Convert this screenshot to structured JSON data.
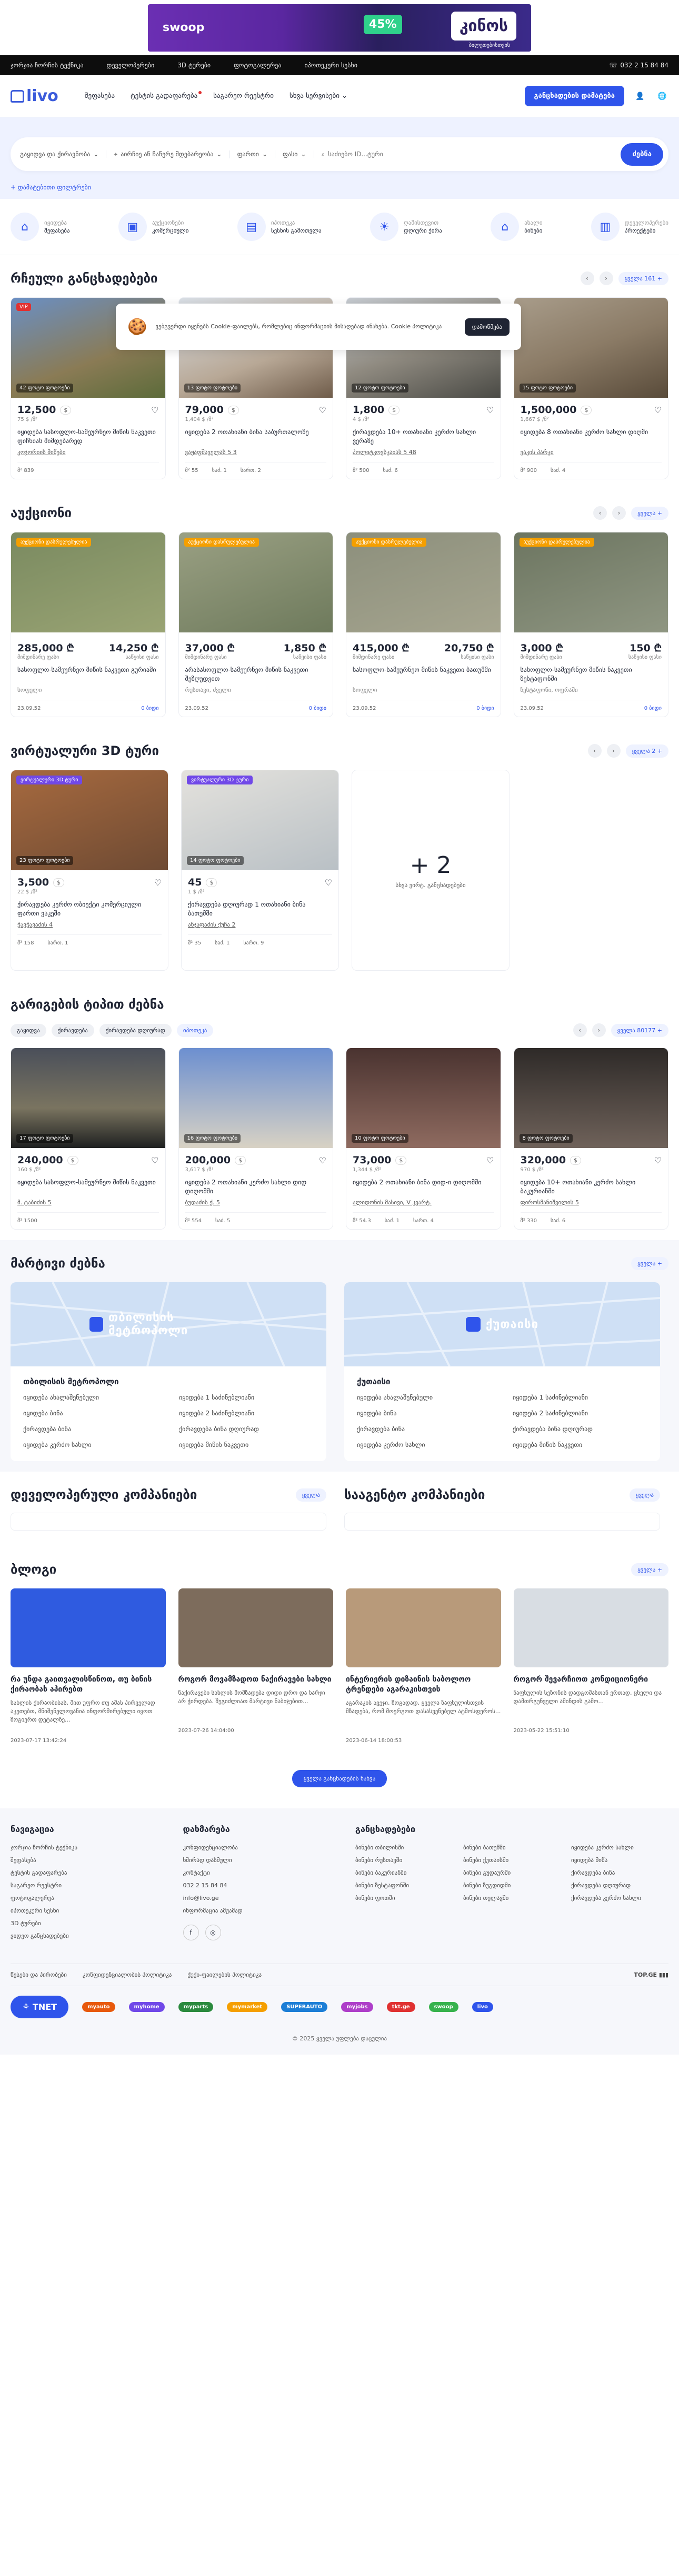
{
  "banner": {
    "logo": "swoop",
    "percent": "45%",
    "headline": "კინოს",
    "sub": "ბილეთებისთვის"
  },
  "topbar": {
    "links": [
      "ჯორჯია ჩორჩის ტექნიკა",
      "დეველოპერები",
      "3D ტურები",
      "ფოტოგალერეა",
      "იპოთეკური სესხი"
    ],
    "phone": "032 2 15 84 84"
  },
  "header": {
    "logo": "livo",
    "nav": [
      "შეფასება",
      "ტესტის გადაფარება",
      "საგარეო რეესტრი",
      "სხვა სერვისები"
    ],
    "cta": "განცხადების დამატება"
  },
  "search": {
    "deal": "გაყიდვა და ქირავნობა",
    "type": "აირჩიე ან ჩაწერე მდებარეობა",
    "price": "ფართი",
    "area": "ფასი",
    "id_placeholder": "საძიებო ID...ტური",
    "button": "ძებნა",
    "advanced": "დამატებითი ფილტრები"
  },
  "categories": [
    {
      "top": "იყიდება",
      "main": "შეფასება",
      "icon": "house-icon"
    },
    {
      "top": "აუქციონები",
      "main": "კომერციული",
      "icon": "briefcase-icon"
    },
    {
      "top": "იპოთეკა",
      "main": "სესხის გამოთვლა",
      "icon": "document-icon"
    },
    {
      "top": "ღამისთევით",
      "main": "დღიური ქირა",
      "icon": "sun-icon"
    },
    {
      "top": "ახალი",
      "main": "ბინები",
      "icon": "building-icon"
    },
    {
      "top": "დეველოპერები",
      "main": "პროექტები",
      "icon": "city-icon"
    }
  ],
  "sections": {
    "rent": {
      "title": "რჩეული განცხადებები",
      "more": "ყველა 161 +"
    },
    "auction": {
      "title": "აუქციონი",
      "more": "ყველა +"
    },
    "tour": {
      "title": "ვირტუალური 3D ტური",
      "more": "ყველა 2 +"
    },
    "popular": {
      "title": "გარიგების ტიპით ძებნა",
      "more": "ყველა 80177 +"
    },
    "maps": {
      "title": "მარტივი ძებნა",
      "more": "ყველა +"
    },
    "dev": {
      "title": "დეველოპერული კომპანიები",
      "more": "ყველა"
    },
    "agency": {
      "title": "სააგენტო კომპანიები",
      "more": "ყველა"
    },
    "blog": {
      "title": "ბლოგი",
      "more": "ყველა +"
    }
  },
  "cookie": {
    "text": "ვებგვერდი იყენებს Cookie-ფაილებს, რომლებიც ინფორმაციის მისაღებად ინახება. Cookie პოლიტიკა",
    "button": "დამოწმება"
  },
  "rent_cards": [
    {
      "price": "12,500",
      "cur": "$",
      "sub": "75 $ /მ²",
      "tag": "42 ფოტო ფოტოები",
      "vip": "VIP",
      "desc": "იყიდება სასოფლო-სამეურნეო მიწის ნაკვეთი ფიჩხიას მიმდებარედ",
      "addr": "კოჯორიის მიწები",
      "m1": "მ² 839",
      "m2": "",
      "m3": ""
    },
    {
      "price": "79,000",
      "cur": "$",
      "sub": "1,404 $ /მ²",
      "tag": "13 ფოტო ფოტოები",
      "vip": "",
      "desc": "იყიდება 2 ოთახიანი ბინა საბურთალოზე",
      "addr": "ვაჟაფშაველას 5 3",
      "m1": "მ² 55",
      "m2": "საძ. 1",
      "m3": "სართ. 2"
    },
    {
      "price": "1,800",
      "cur": "$",
      "sub": "4 $ /მ²",
      "tag": "12 ფოტო ფოტოები",
      "vip": "",
      "desc": "ქირავდება 10+ ოთახიანი კერძო სახლი ვერაზე",
      "addr": "პოლიტკოვსკაიას 5 48",
      "m1": "მ² 500",
      "m2": "საძ. 6",
      "m3": ""
    },
    {
      "price": "1,500,000",
      "cur": "$",
      "sub": "1,667 $ /მ²",
      "tag": "15 ფოტო ფოტოები",
      "vip": "",
      "desc": "იყიდება 8 ოთახიანი კერძო სახლი დიღმი",
      "addr": "ვაკის პარკი",
      "m1": "მ² 900",
      "m2": "საძ. 4",
      "m3": ""
    }
  ],
  "auction_cards": [
    {
      "status": "აუქციონი დასრულებულია",
      "price": "285,000 ₾",
      "min": "14,250 ₾",
      "l1": "მიმდინარე ფასი",
      "l2": "საწყისი ფასი",
      "desc": "სასოფლო-სამეურნეო მიწის ნაკვეთი გურიაში",
      "addr": "სოფელი",
      "date": "23.09.52",
      "link": "0 ბიდი"
    },
    {
      "status": "აუქციონი დასრულებულია",
      "price": "37,000 ₾",
      "min": "1,850 ₾",
      "l1": "მიმდინარე ფასი",
      "l2": "საწყისი ფასი",
      "desc": "არასასოფლო-სამეურნეო მიწის ნაკვეთი შეზღუდვით",
      "addr": "რუსთავი, ძველი",
      "date": "23.09.52",
      "link": "0 ბიდი"
    },
    {
      "status": "აუქციონი დასრულებულია",
      "price": "415,000 ₾",
      "min": "20,750 ₾",
      "l1": "მიმდინარე ფასი",
      "l2": "საწყისი ფასი",
      "desc": "სასოფლო-სამეურნეო მიწის ნაკვეთი ბათუმში",
      "addr": "სოფელი",
      "date": "23.09.52",
      "link": "0 ბიდი"
    },
    {
      "status": "აუქციონი დასრულებულია",
      "price": "3,000 ₾",
      "min": "150 ₾",
      "l1": "მიმდინარე ფასი",
      "l2": "საწყისი ფასი",
      "desc": "სასოფლო-სამეურნეო მიწის ნაკვეთი ზესტაფონში",
      "addr": "ზესტაფონი, ოფრაში",
      "date": "23.09.52",
      "link": "0 ბიდი"
    }
  ],
  "tour_cards": [
    {
      "badge": "ვირტუალური 3D ტური",
      "price": "3,500",
      "cur": "$",
      "sub": "22 $ /მ²",
      "tag": "23 ფოტო ფოტოები",
      "desc": "ქირავდება კერძო ობიექტი კომერციული ფართი ვაკეში",
      "addr": "ჭავჭავაძის 4",
      "m1": "მ² 158",
      "m2": "სართ. 1"
    },
    {
      "badge": "ვირტუალური 3D ტური",
      "price": "45",
      "cur": "$",
      "sub": "1 $ /მ²",
      "tag": "14 ფოტო ფოტოები",
      "desc": "ქირავდება დღიურად 1 ოთახიანი ბინა ბათუმში",
      "addr": "ანჯაფაძის ქუჩა 2",
      "m1": "მ² 35",
      "m2": "საძ. 1",
      "m3": "სართ. 9"
    }
  ],
  "tour_more": {
    "count": "+ 2",
    "label": "სხვა ვირტ. განცხადებები"
  },
  "chips": [
    "გაყიდვა",
    "ქირავდება",
    "ქირავდება დღიურად",
    "იპოთეკა"
  ],
  "popular_cards": [
    {
      "price": "240,000",
      "cur": "$",
      "sub": "160 $ /მ²",
      "tag": "17 ფოტო ფოტოები",
      "desc": "იყიდება სასოფლო-სამეურნეო მიწის ნაკვეთი",
      "addr": "მ. ტაბიძის 5",
      "m1": "მ² 1500",
      "m2": "",
      "m3": ""
    },
    {
      "price": "200,000",
      "cur": "$",
      "sub": "3,617 $ /მ²",
      "tag": "16 ფოტო ფოტოები",
      "desc": "იყიდება 2 ოთახიანი კერძო სახლი დიდ დიღომში",
      "addr": "ბუდაძის ქ. 5",
      "m1": "მ² 554",
      "m2": "საძ. 5",
      "m3": ""
    },
    {
      "price": "73,000",
      "cur": "$",
      "sub": "1,344 $ /მ²",
      "tag": "10 ფოტო ფოტოები",
      "desc": "იყიდება 2 ოთახიანი ბინა დიდ-ი დიღომში",
      "addr": "ალიდონის მასივი, V კვარტ.",
      "m1": "მ² 54.3",
      "m2": "საძ. 1",
      "m3": "სართ. 4"
    },
    {
      "price": "320,000",
      "cur": "$",
      "sub": "970 $ /მ²",
      "tag": "8 ფოტო ფოტოები",
      "desc": "იყიდება 10+ ოთახიანი კერძო სახლი ბაკურიანში",
      "addr": "ფიროსმანიშვილის 5",
      "m1": "მ² 330",
      "m2": "საძ. 6",
      "m3": ""
    }
  ],
  "maps": [
    {
      "label": "თბილისის მეტროპოლი",
      "title": "თბილისის მეტროპოლი",
      "links": [
        "იყიდება ახალაშენებული",
        "იყიდება 1 საძინებლიანი",
        "იყიდება ბინა",
        "იყიდება 2 საძინებლიანი",
        "ქირავდება ბინა",
        "ქირავდება ბინა დღიურად",
        "იყიდება კერძო სახლი",
        "იყიდება მიწის ნაკვეთი"
      ]
    },
    {
      "label": "ქუთაისი",
      "title": "ქუთაისი",
      "links": [
        "იყიდება ახალაშენებული",
        "იყიდება 1 საძინებლიანი",
        "იყიდება ბინა",
        "იყიდება 2 საძინებლიანი",
        "ქირავდება ბინა",
        "ქირავდება ბინა დღიურად",
        "იყიდება კერძო სახლი",
        "იყიდება მიწის ნაკვეთი"
      ]
    }
  ],
  "blog": [
    {
      "title": "რა უნდა გაითვალისწინოთ, თუ ბინის ქირაობას აპირებთ",
      "desc": "სახლის ქირაობისას, მით უფრო თუ ამას პირველად აკეთებთ, მნიშვნელოვანია ინფორმირებული იყოთ ზოგიერთ დეტალზე...",
      "date": "2023-07-17 13:42:24",
      "color": "#2f5be0"
    },
    {
      "title": "როგორ მოვამზადოთ ნაქირავები სახლი",
      "desc": "ნაქირავები სახლის მომზადება დიდი დრო და ხარჯი არ ჭირდება. შეგიძლიათ მარტივი ნაბიჯებით...",
      "date": "2023-07-26 14:04:00",
      "color": "#7d6c5c"
    },
    {
      "title": "ინტერიერის დიზაინის საბოლოო ტრენდები აგარაკისთვის",
      "desc": "აგარაკის ავეჯი, ზოგადად, ყველა ზაფხულისთვის მზადება, რომ მოერგოთ დასასვენებელ ატმოსფეროს...",
      "date": "2023-06-14 18:00:53",
      "color": "#b89a7a"
    },
    {
      "title": "როგორ შევარჩიოთ კონდიციონერი",
      "desc": "ზაფხულის სეზონის დადგომასთან ერთად, ცხელი და დამთრგუნველი ამინდის გამო...",
      "date": "2023-05-22 15:51:10",
      "color": "#d8dde3"
    }
  ],
  "more_button": "ყველა განცხადების ნახვა",
  "footer": {
    "nav_title": "ნავიგაცია",
    "nav": [
      "ჯორჯია ჩორჩის ტექნიკა",
      "შეფასება",
      "ტესტის გადაფარება",
      "საგარეო რეესტრი",
      "ფოტოგალერეა",
      "იპოთეკური სესხი",
      "3D ტურები",
      "ვიდეო განცხადებები"
    ],
    "help_title": "დახმარება",
    "help": [
      "კონფიდენციალობა",
      "ხშირად დასმული",
      "კონტაქტი",
      "032 2 15 84 84",
      "info@livo.ge",
      "ინფორმაცია ამჟამად"
    ],
    "list_title": "განცხადებები",
    "list": [
      "ბინები თბილისში",
      "ბინები ბათუმში",
      "იყიდება კერძო სახლი",
      "ბინები რუსთავში",
      "ბინები ქუთაისში",
      "იყიდება მიწა",
      "ბინები ბაკურიანში",
      "ბინები გუდაურში",
      "ქირავდება ბინა",
      "ბინები ზესტაფონში",
      "ბინები ზუგდიდში",
      "ქირავდება დღიურად",
      "ბინები ფოთში",
      "ბინები თელავში",
      "ქირავდება კერძო სახლი"
    ],
    "legal": [
      "წესები და პირობები",
      "კონფიდენციალობის პოლიტიკა",
      "ქუქი-ფაილების პოლიტიკა"
    ],
    "partners": [
      "myauto",
      "myhome",
      "myparts",
      "mymarket",
      "SUPERAUTO",
      "myjobs",
      "tkt.ge",
      "swoop",
      "livo"
    ],
    "copyright": "© 2025 ყველა უფლება დაცულია"
  }
}
